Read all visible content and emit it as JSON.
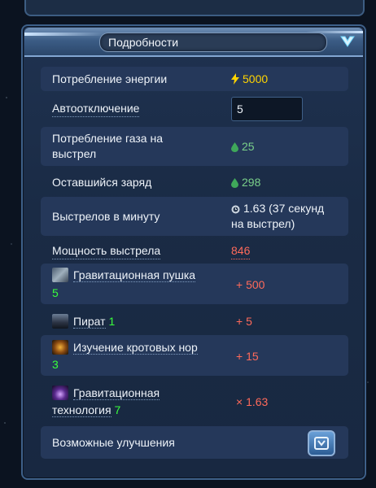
{
  "panel": {
    "title": "Подробности",
    "toggle_icon": "chevron-down-icon"
  },
  "rows": {
    "energy": {
      "label": "Потребление энергии",
      "value": "5000",
      "icon": "lightning-icon"
    },
    "autooff": {
      "label": "Автоотключение",
      "value": "5"
    },
    "gas": {
      "label_line1": "Потребление газа на",
      "label_line2": "выстрел",
      "value": "25",
      "icon": "gas-drop-icon"
    },
    "charge": {
      "label": "Оставшийся заряд",
      "value": "298",
      "icon": "gas-drop-icon"
    },
    "rate": {
      "label": "Выстрелов в минуту",
      "value_line1": "1.63 (37 секунд",
      "value_line2": "на выстрел)",
      "icon": "clock-icon"
    },
    "power": {
      "label": "Мощность выстрела",
      "value": "846"
    },
    "gravgun": {
      "label": "Гравитационная пушка",
      "level": "5",
      "value": "+ 500",
      "icon": "gravity-cannon-icon"
    },
    "pirate": {
      "label": "Пират",
      "level": "1",
      "value": "+ 5",
      "icon": "pirate-portrait-icon"
    },
    "wormhole": {
      "label": "Изучение кротовых нор",
      "level": "3",
      "value": "+ 15",
      "icon": "wormhole-research-icon"
    },
    "gravtech": {
      "label_line1": "Гравитационная",
      "label_line2": "технология",
      "level": "7",
      "value": "× 1.63",
      "icon": "gravity-tech-icon"
    },
    "upgrades": {
      "label": "Возможные улучшения",
      "icon": "upgrade-icon"
    }
  },
  "colors": {
    "energy": "#ffd400",
    "gas": "#7ad08a",
    "bonus": "#ff6a5a",
    "level": "#39ff3c",
    "panel_bg": "#1c2d48"
  }
}
